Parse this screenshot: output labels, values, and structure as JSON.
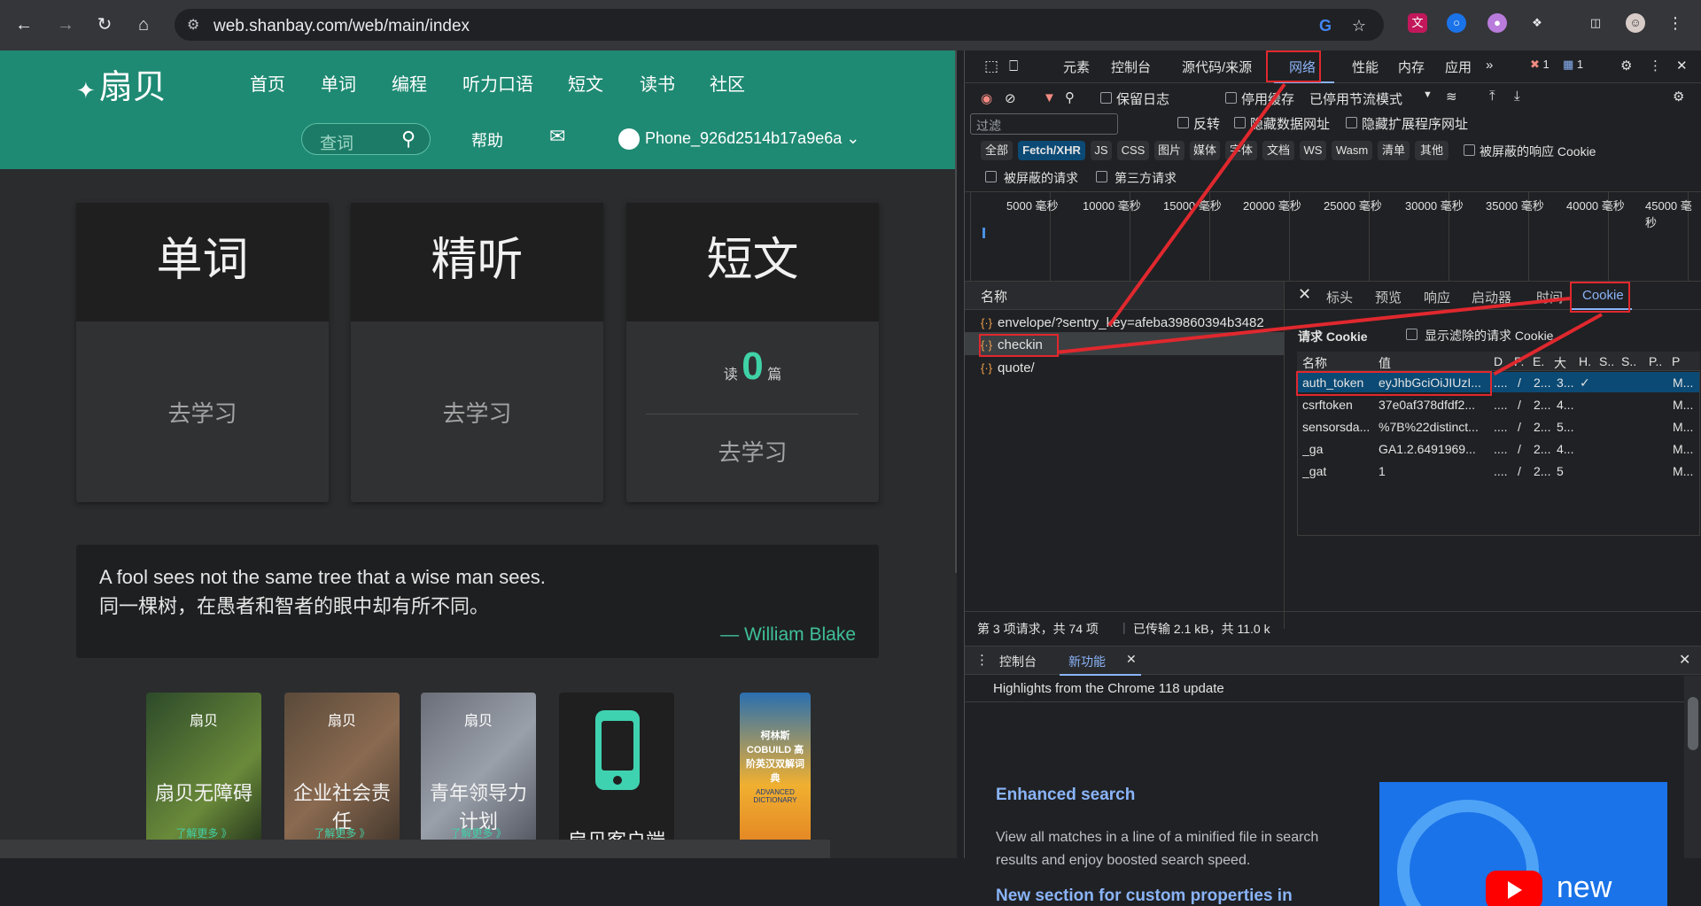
{
  "browser": {
    "url": "web.shanbay.com/web/main/index"
  },
  "site": {
    "logo": "扇贝",
    "nav": [
      "首页",
      "单词",
      "编程",
      "听力口语",
      "短文",
      "读书",
      "社区"
    ],
    "search_placeholder": "查词",
    "help": "帮助",
    "username": "Phone_926d2514b17a9e6a",
    "cards": [
      {
        "title": "单词",
        "action": "去学习"
      },
      {
        "title": "精听",
        "action": "去学习"
      },
      {
        "title": "短文",
        "read_prefix": "读",
        "read_count": "0",
        "read_suffix": "篇",
        "action": "去学习"
      }
    ],
    "quote": {
      "en": "A fool sees not the same tree that a wise man sees.",
      "zh": "同一棵树，在愚者和智者的眼中却有所不同。",
      "author": "— William Blake"
    },
    "promos": [
      {
        "logo": "扇贝",
        "title": "扇贝无障碍",
        "more": "了解更多 》"
      },
      {
        "logo": "扇贝",
        "title": "企业社会责任",
        "more": "了解更多 》"
      },
      {
        "logo": "扇贝",
        "title": "青年领导力计划",
        "more": "了解更多 》"
      },
      {
        "title": "扇贝客户端"
      },
      {
        "title": "柯林斯COBUILD 高阶英汉双解词典",
        "sub": "ADVANCED DICTIONARY"
      }
    ]
  },
  "devtools": {
    "tabs": [
      "元素",
      "控制台",
      "源代码/来源",
      "网络",
      "性能",
      "内存",
      "应用"
    ],
    "active_tab": "网络",
    "errors": "1",
    "messages": "1",
    "toolbar": {
      "preserve_log": "保留日志",
      "disable_cache": "停用缓存",
      "throttle": "已停用节流模式"
    },
    "filter": {
      "placeholder": "过滤",
      "invert": "反转",
      "hide_data_urls": "隐藏数据网址",
      "hide_ext_urls": "隐藏扩展程序网址",
      "chips": [
        "全部",
        "Fetch/XHR",
        "JS",
        "CSS",
        "图片",
        "媒体",
        "字体",
        "文档",
        "WS",
        "Wasm",
        "清单",
        "其他"
      ],
      "selected_chip": "Fetch/XHR",
      "blocked_cookies": "被屏蔽的响应 Cookie",
      "blocked_requests": "被屏蔽的请求",
      "third_party": "第三方请求"
    },
    "timeline_ticks": [
      "5000 毫秒",
      "10000 毫秒",
      "15000 毫秒",
      "20000 毫秒",
      "25000 毫秒",
      "30000 毫秒",
      "35000 毫秒",
      "40000 毫秒",
      "45000 毫秒"
    ],
    "requests": {
      "header": "名称",
      "items": [
        "envelope/?sentry_key=afeba39860394b3482",
        "checkin",
        "quote/"
      ],
      "selected": "checkin"
    },
    "detail_tabs": [
      "标头",
      "预览",
      "响应",
      "启动器",
      "时间",
      "Cookie"
    ],
    "active_detail_tab": "Cookie",
    "cookies": {
      "title": "请求 Cookie",
      "show_filtered": "显示滤除的请求 Cookie",
      "columns": [
        "名称",
        "值",
        "D",
        "P.",
        "E.",
        "大",
        "H.",
        "S..",
        "S..",
        "P..",
        "P"
      ],
      "rows": [
        [
          "auth_token",
          "eyJhbGciOiJIUzI...",
          "....",
          "/",
          "2...",
          "3...",
          "✓",
          "",
          "",
          "",
          "M..."
        ],
        [
          "csrftoken",
          "37e0af378dfdf2...",
          "....",
          "/",
          "2...",
          "4...",
          "",
          "",
          "",
          "",
          "M..."
        ],
        [
          "sensorsda...",
          "%7B%22distinct...",
          "....",
          "/",
          "2...",
          "5...",
          "",
          "",
          "",
          "",
          "M..."
        ],
        [
          "_ga",
          "GA1.2.6491969...",
          "....",
          "/",
          "2...",
          "4...",
          "",
          "",
          "",
          "",
          "M..."
        ],
        [
          "_gat",
          "1",
          "....",
          "/",
          "2...",
          "5",
          "",
          "",
          "",
          "",
          "M..."
        ]
      ]
    },
    "status": {
      "requests": "第 3 项请求，共 74 项",
      "transferred": "已传输 2.1 kB，共 11.0 k"
    },
    "drawer": {
      "tabs": [
        "控制台",
        "新功能"
      ],
      "active": "新功能",
      "headline": "Highlights from the Chrome 118 update",
      "feature1_title": "Enhanced search",
      "feature1_desc": "View all matches in a line of a minified file in search results and enjoy boosted search speed.",
      "feature2_title": "New section for custom properties in",
      "video_label": "new"
    }
  },
  "colors": {
    "site_green": "#1f8a73",
    "accent_red": "#e0282e",
    "selected_row": "#0b4a75"
  }
}
